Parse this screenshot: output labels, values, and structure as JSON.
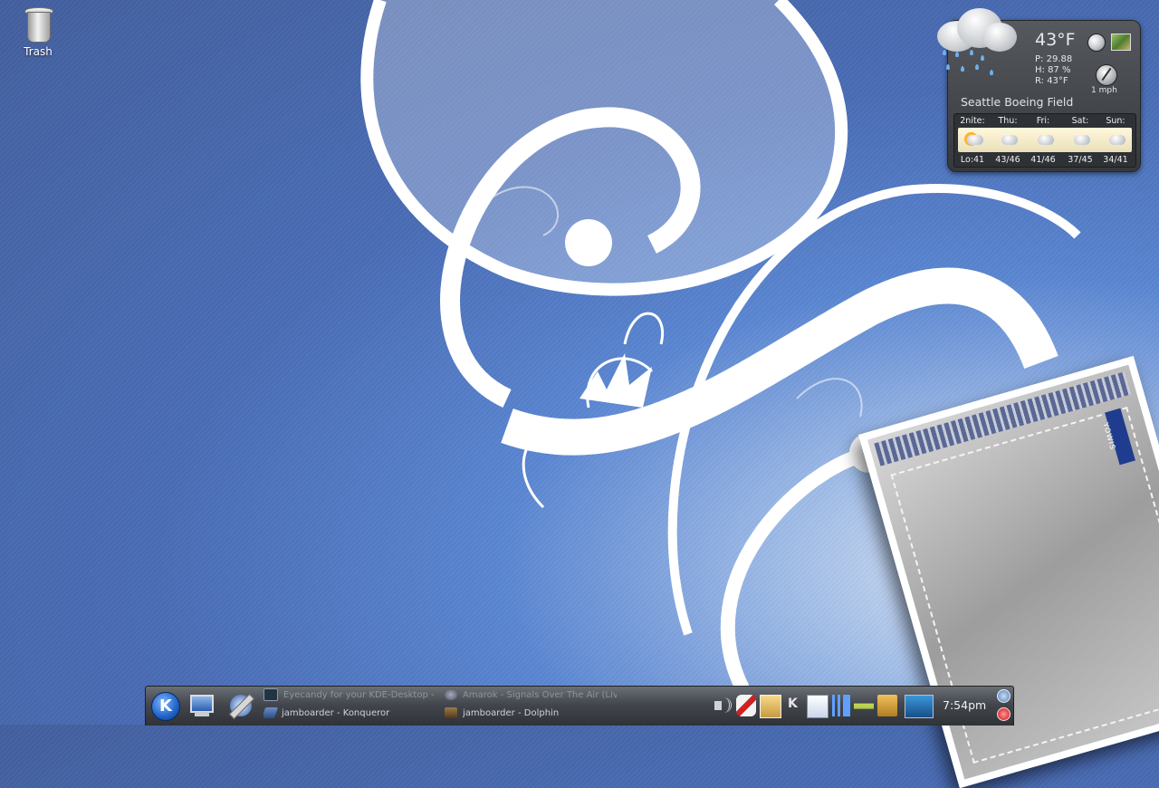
{
  "desktop": {
    "icons": [
      {
        "label": "Trash",
        "icon": "trash-icon"
      }
    ]
  },
  "weather": {
    "temperature": "43°F",
    "pressure": "P:  29.88",
    "humidity": "H:  87 %",
    "realfeel": "R:  43°F",
    "wind": "1 mph",
    "city": "Seattle Boeing Field",
    "forecast": [
      {
        "day": "2nite:",
        "temp": "Lo:41"
      },
      {
        "day": "Thu:",
        "temp": "43/46"
      },
      {
        "day": "Fri:",
        "temp": "41/46"
      },
      {
        "day": "Sat:",
        "temp": "37/45"
      },
      {
        "day": "Sun:",
        "temp": "34/41"
      }
    ]
  },
  "card": {
    "tag": "YOWIS"
  },
  "taskbar": {
    "tasks": [
      {
        "label": "Eyecandy for your KDE-Desktop - Ko",
        "icon": "kde-look-icon"
      },
      {
        "label": "Amarok - Signals Over The Air (Live",
        "icon": "amarok-icon"
      },
      {
        "label": "jamboarder - Konqueror",
        "icon": "konqueror-icon"
      },
      {
        "label": "jamboarder - Dolphin",
        "icon": "dolphin-icon"
      }
    ],
    "clock": "7:54pm"
  }
}
